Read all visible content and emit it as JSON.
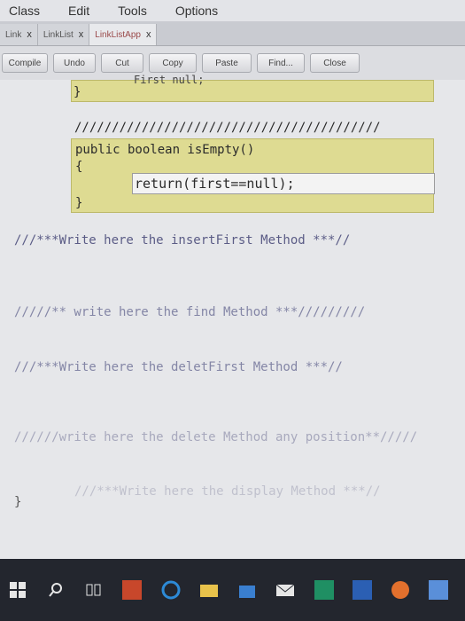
{
  "menu": [
    "Class",
    "Edit",
    "Tools",
    "Options"
  ],
  "tabs": [
    {
      "label": "Link",
      "close": "x",
      "active": false
    },
    {
      "label": "LinkList",
      "close": "x",
      "active": false
    },
    {
      "label": "LinkListApp",
      "close": "x",
      "active": true
    }
  ],
  "toolbar": {
    "compile": "Compile",
    "undo": "Undo",
    "cut": "Cut",
    "copy": "Copy",
    "paste": "Paste",
    "find": "Find...",
    "close": "Close"
  },
  "code": {
    "partial_top": "First null;",
    "brace_close_1": "}",
    "slashes": "/////////////////////////////////////////",
    "method_sig": "public boolean isEmpty()",
    "brace_open": "{",
    "return_stmt": "return(first==null);",
    "brace_close_2": "}",
    "comment_insert": "///***Write here the insertFirst Method ***//",
    "comment_find": "/////** write here the find Method ***/////////",
    "comment_delet": "///***Write here the deletFirst Method ***//",
    "comment_delete": "//////write here the delete Method any position**/////",
    "comment_display": "///***Write here the display Method ***//",
    "brace_final": "}"
  },
  "colors": {
    "method_block": "#dedb92",
    "comment": "#5b5c86"
  }
}
